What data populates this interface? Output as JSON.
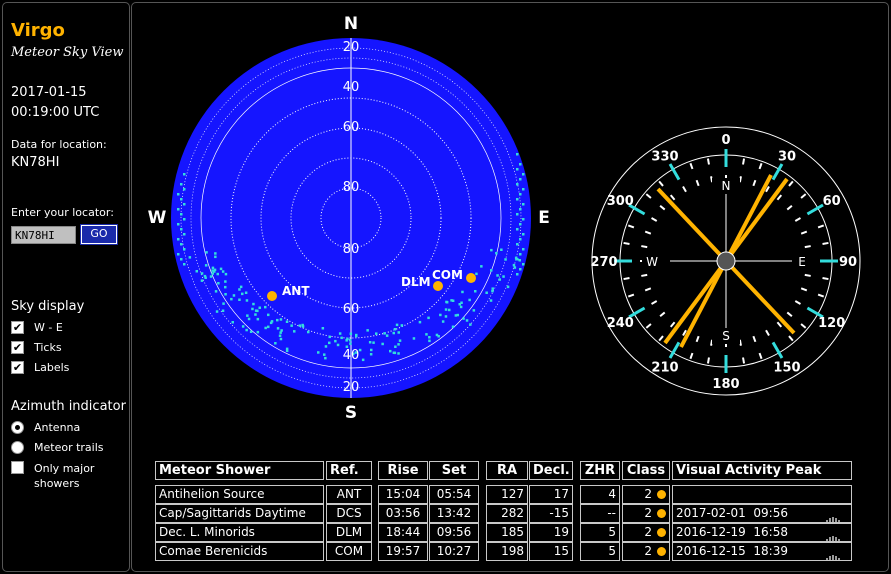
{
  "sidebar": {
    "app_title": "Virgo",
    "app_subtitle": "Meteor Sky View",
    "date": "2017-01-15",
    "time": "00:19:00 UTC",
    "location_label": "Data for location:",
    "location_value": "KN78HI",
    "locator_label": "Enter your locator:",
    "locator_input_value": "KN78HI",
    "go_label": "GO",
    "sky_display_title": "Sky display",
    "sky_options": [
      {
        "label": "W - E",
        "checked": true
      },
      {
        "label": "Ticks",
        "checked": true
      },
      {
        "label": "Labels",
        "checked": true
      }
    ],
    "azimuth_title": "Azimuth indicator",
    "azimuth_options": [
      {
        "label": "Antenna",
        "selected": true
      },
      {
        "label": "Meteor trails",
        "selected": false
      }
    ],
    "major_only_label_1": "Only major",
    "major_only_label_2": "showers",
    "major_only_checked": false
  },
  "sky": {
    "north": "N",
    "south": "S",
    "west": "W",
    "east": "E",
    "alt_labels_top": [
      "20",
      "40",
      "60",
      "80"
    ],
    "alt_labels_bottom": [
      "80",
      "60",
      "40",
      "20"
    ],
    "shower_labels": [
      "ANT",
      "DLM",
      "COM"
    ],
    "colors": {
      "sky": "#1515ff",
      "dots": "#33dddd",
      "shower": "#ffb300"
    }
  },
  "compass": {
    "azimuth_labels": [
      "0",
      "30",
      "60",
      "90",
      "120",
      "150",
      "180",
      "210",
      "240",
      "270",
      "300",
      "330"
    ],
    "cardinal": {
      "n": "N",
      "e": "E",
      "s": "S",
      "w": "W"
    }
  },
  "table": {
    "headers": [
      "Meteor Shower",
      "Ref.",
      "Rise",
      "Set",
      "RA",
      "Decl.",
      "ZHR",
      "Class",
      "Visual Activity Peak"
    ],
    "rows": [
      {
        "name": "Antihelion Source",
        "ref": "ANT",
        "rise": "15:04",
        "set": "05:54",
        "ra": "127",
        "decl": "17",
        "zhr": "4",
        "class": "2",
        "peak_date": "",
        "peak_time": ""
      },
      {
        "name": "Cap/Sagittarids Daytime",
        "ref": "DCS",
        "rise": "03:56",
        "set": "13:42",
        "ra": "282",
        "decl": "-15",
        "zhr": "--",
        "class": "2",
        "peak_date": "2017-02-01",
        "peak_time": "09:56"
      },
      {
        "name": "Dec. L. Minorids",
        "ref": "DLM",
        "rise": "18:44",
        "set": "09:56",
        "ra": "185",
        "decl": "19",
        "zhr": "5",
        "class": "2",
        "peak_date": "2016-12-19",
        "peak_time": "16:58"
      },
      {
        "name": "Comae Berenicids",
        "ref": "COM",
        "rise": "19:57",
        "set": "10:27",
        "ra": "198",
        "decl": "15",
        "zhr": "5",
        "class": "2",
        "peak_date": "2016-12-15",
        "peak_time": "18:39"
      }
    ]
  }
}
